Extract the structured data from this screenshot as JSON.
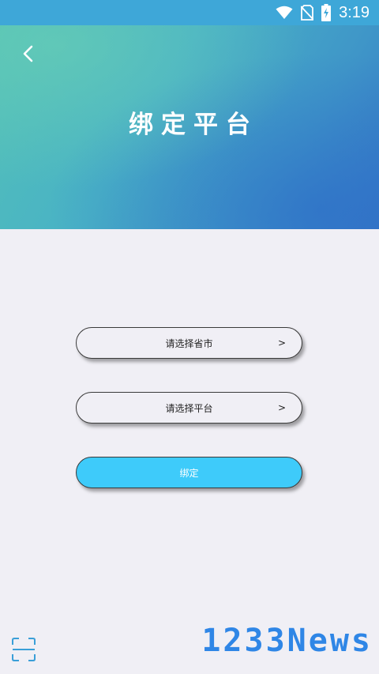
{
  "status_bar": {
    "time": "3:19",
    "icons": [
      "wifi-icon",
      "no-sim-icon",
      "battery-charging-icon"
    ]
  },
  "header": {
    "back_icon": "chevron-left-icon",
    "title": "绑定平台"
  },
  "form": {
    "province_select": {
      "label": "请选择省市",
      "arrow": ">"
    },
    "platform_select": {
      "label": "请选择平台",
      "arrow": ">"
    },
    "bind_button": {
      "label": "绑定"
    }
  },
  "footer": {
    "scan_icon": "scan-icon",
    "watermark": "1233News"
  },
  "colors": {
    "status_bar": "#3ea7d8",
    "header_start": "#52c0b8",
    "header_end": "#3678c6",
    "background": "#f0eff5",
    "primary_button": "#3ecbfa",
    "watermark": "#2f86e6"
  }
}
